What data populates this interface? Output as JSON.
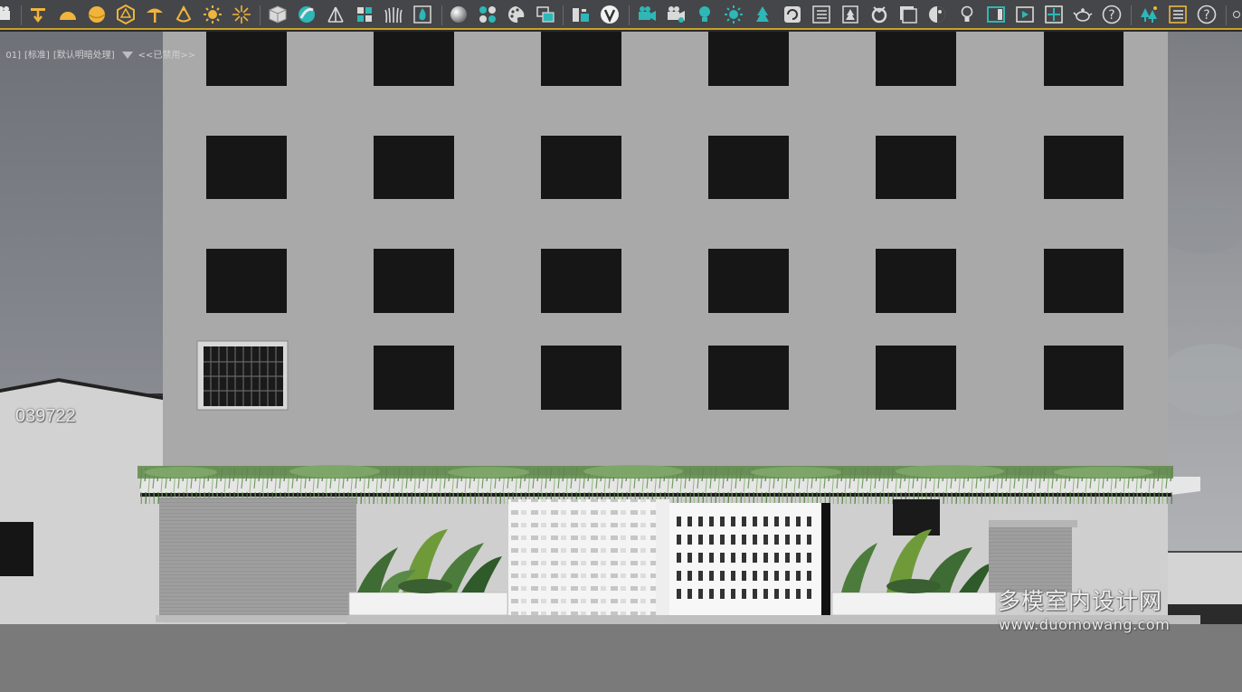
{
  "viewport": {
    "label_parts": [
      "01]",
      "[标准]",
      "[默认明暗处理]",
      "<<已禁用>>"
    ],
    "side_number": "039722",
    "watermark_cn": "多模室内设计网",
    "watermark_url": "www.duomowang.com"
  },
  "toolbar": {
    "icons": [
      "camera-icon",
      "spotlight-yellow-icon",
      "dome-light-icon",
      "sphere-light-icon",
      "geosphere-icon",
      "umbrella-light-icon",
      "photometric-light-icon",
      "sun-icon",
      "sky-burst-icon",
      "box-object-icon",
      "vray-sphere-icon",
      "plane-tripod-icon",
      "proxy-icon",
      "fur-icon",
      "fire-icon",
      "material-ball-icon",
      "material-grid-icon",
      "palette-icon",
      "render-material-icon",
      "scene-converter-icon",
      "vray-logo-icon",
      "video-camera-icon",
      "video-camera-2-icon",
      "light-bulb-icon",
      "sun-gear-icon",
      "tree-icon",
      "refresh-render-icon",
      "list-icon",
      "tree-frame-icon",
      "render-setup-icon",
      "frame-buffer-icon",
      "lighting-analysis-icon",
      "bulb-outline-icon",
      "window-icon",
      "play-render-icon",
      "region-render-icon",
      "teapot-icon",
      "help-icon",
      "forest-icon",
      "menu-list-icon",
      "help-2-icon"
    ],
    "colors": {
      "accent": "#c9a227",
      "toolbar_bg": "#444649",
      "icon_yellow": "#f0b43c",
      "icon_teal": "#2fb6b6"
    }
  }
}
